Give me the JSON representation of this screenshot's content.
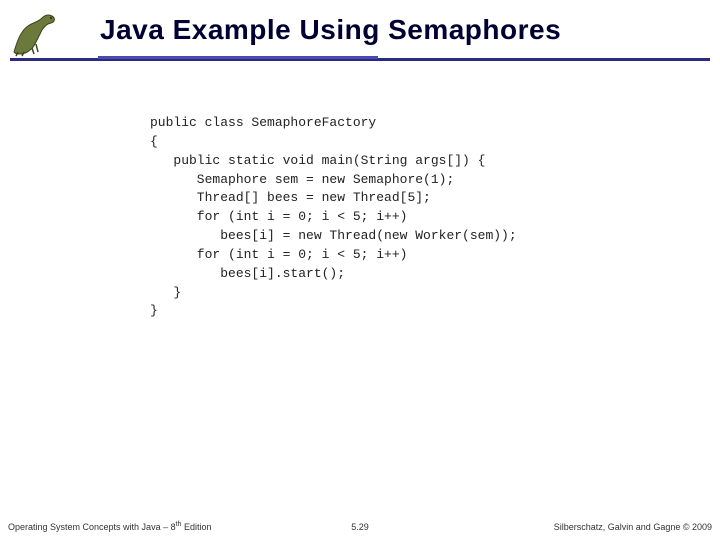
{
  "header": {
    "title": "Java Example Using Semaphores",
    "logo_alt": "dinosaur-logo"
  },
  "code": {
    "lines": [
      "public class SemaphoreFactory",
      "{",
      "   public static void main(String args[]) {",
      "      Semaphore sem = new Semaphore(1);",
      "      Thread[] bees = new Thread[5];",
      "",
      "      for (int i = 0; i < 5; i++)",
      "         bees[i] = new Thread(new Worker(sem));",
      "      for (int i = 0; i < 5; i++)",
      "         bees[i].start();",
      "   }",
      "}"
    ]
  },
  "footer": {
    "left_prefix": "Operating System Concepts with Java – 8",
    "left_sup": "th",
    "left_suffix": " Edition",
    "center": "5.29",
    "right": "Silberschatz, Galvin and Gagne © 2009"
  }
}
